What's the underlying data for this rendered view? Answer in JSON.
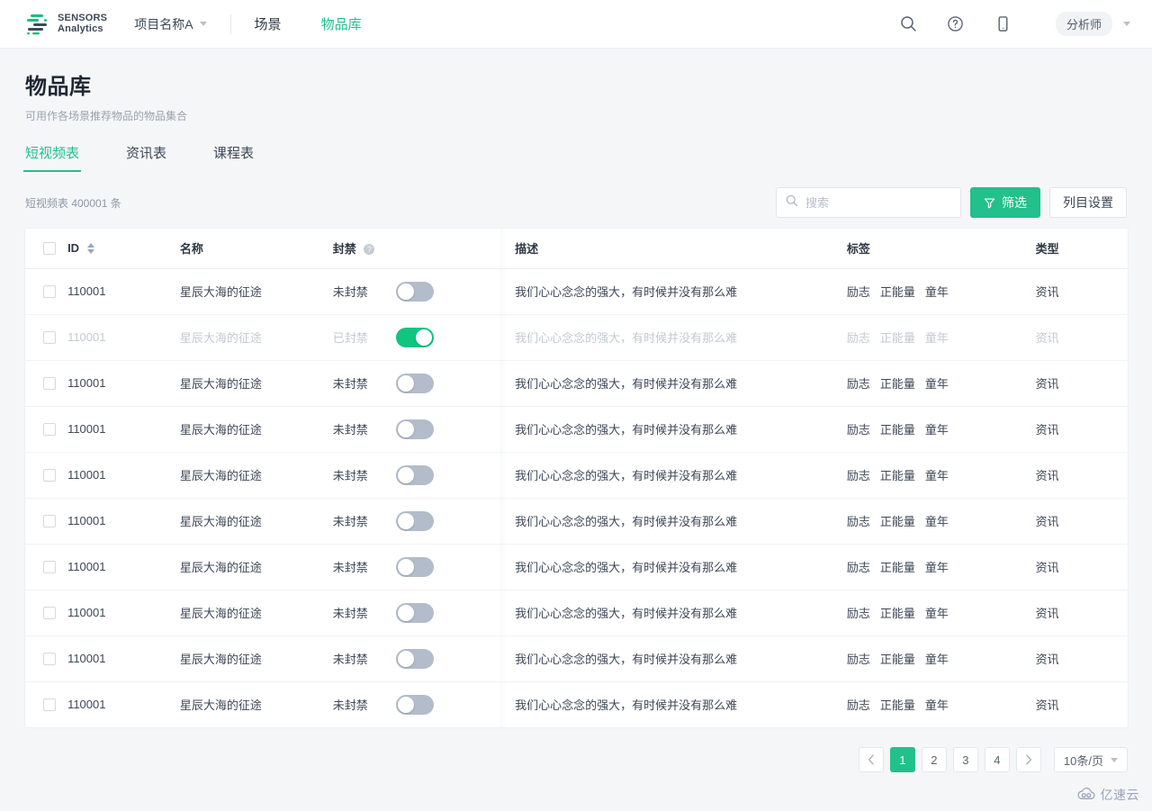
{
  "topbar": {
    "logo": {
      "line1": "SENSORS",
      "line2": "Analytics",
      "icon": "sensors-logo-icon"
    },
    "project": {
      "label": "项目名称A",
      "caret_icon": "chevron-down-icon"
    },
    "nav": [
      {
        "label": "场景",
        "active": false
      },
      {
        "label": "物品库",
        "active": true
      }
    ],
    "icons": [
      {
        "name": "search-icon"
      },
      {
        "name": "help-circle-icon"
      },
      {
        "name": "mobile-icon"
      }
    ],
    "role": {
      "label": "分析师",
      "caret_icon": "chevron-down-icon"
    }
  },
  "page": {
    "title": "物品库",
    "subtitle": "可用作各场景推荐物品的物品集合"
  },
  "tabs": [
    {
      "label": "短视频表",
      "active": true
    },
    {
      "label": "资讯表",
      "active": false
    },
    {
      "label": "课程表",
      "active": false
    }
  ],
  "toolbar": {
    "count_text": "短视频表 400001 条",
    "search": {
      "placeholder": "搜索",
      "value": "",
      "icon": "search-icon"
    },
    "filter_button": {
      "label": "筛选",
      "icon": "filter-funnel-icon"
    },
    "columns_button": {
      "label": "列目设置"
    }
  },
  "table": {
    "columns": [
      {
        "key": "checkbox",
        "label": ""
      },
      {
        "key": "id",
        "label": "ID",
        "sortable": true
      },
      {
        "key": "name",
        "label": "名称"
      },
      {
        "key": "ban",
        "label": "封禁",
        "help": true
      },
      {
        "key": "desc",
        "label": "描述"
      },
      {
        "key": "tags",
        "label": "标签"
      },
      {
        "key": "type",
        "label": "类型"
      }
    ],
    "ban_labels": {
      "on": "已封禁",
      "off": "未封禁"
    },
    "rows": [
      {
        "id": "110001",
        "name": "星辰大海的征途",
        "ban_label": "未封禁",
        "banned": false,
        "desc": "我们心心念念的强大，有时候并没有那么难",
        "tags": [
          "励志",
          "正能量",
          "童年"
        ],
        "type": "资讯",
        "disabled": false
      },
      {
        "id": "110001",
        "name": "星辰大海的征途",
        "ban_label": "已封禁",
        "banned": true,
        "desc": "我们心心念念的强大，有时候并没有那么难",
        "tags": [
          "励志",
          "正能量",
          "童年"
        ],
        "type": "资讯",
        "disabled": true
      },
      {
        "id": "110001",
        "name": "星辰大海的征途",
        "ban_label": "未封禁",
        "banned": false,
        "desc": "我们心心念念的强大，有时候并没有那么难",
        "tags": [
          "励志",
          "正能量",
          "童年"
        ],
        "type": "资讯",
        "disabled": false
      },
      {
        "id": "110001",
        "name": "星辰大海的征途",
        "ban_label": "未封禁",
        "banned": false,
        "desc": "我们心心念念的强大，有时候并没有那么难",
        "tags": [
          "励志",
          "正能量",
          "童年"
        ],
        "type": "资讯",
        "disabled": false
      },
      {
        "id": "110001",
        "name": "星辰大海的征途",
        "ban_label": "未封禁",
        "banned": false,
        "desc": "我们心心念念的强大，有时候并没有那么难",
        "tags": [
          "励志",
          "正能量",
          "童年"
        ],
        "type": "资讯",
        "disabled": false
      },
      {
        "id": "110001",
        "name": "星辰大海的征途",
        "ban_label": "未封禁",
        "banned": false,
        "desc": "我们心心念念的强大，有时候并没有那么难",
        "tags": [
          "励志",
          "正能量",
          "童年"
        ],
        "type": "资讯",
        "disabled": false
      },
      {
        "id": "110001",
        "name": "星辰大海的征途",
        "ban_label": "未封禁",
        "banned": false,
        "desc": "我们心心念念的强大，有时候并没有那么难",
        "tags": [
          "励志",
          "正能量",
          "童年"
        ],
        "type": "资讯",
        "disabled": false
      },
      {
        "id": "110001",
        "name": "星辰大海的征途",
        "ban_label": "未封禁",
        "banned": false,
        "desc": "我们心心念念的强大，有时候并没有那么难",
        "tags": [
          "励志",
          "正能量",
          "童年"
        ],
        "type": "资讯",
        "disabled": false
      },
      {
        "id": "110001",
        "name": "星辰大海的征途",
        "ban_label": "未封禁",
        "banned": false,
        "desc": "我们心心念念的强大，有时候并没有那么难",
        "tags": [
          "励志",
          "正能量",
          "童年"
        ],
        "type": "资讯",
        "disabled": false
      },
      {
        "id": "110001",
        "name": "星辰大海的征途",
        "ban_label": "未封禁",
        "banned": false,
        "desc": "我们心心念念的强大，有时候并没有那么难",
        "tags": [
          "励志",
          "正能量",
          "童年"
        ],
        "type": "资讯",
        "disabled": false
      }
    ]
  },
  "pagination": {
    "prev_icon": "chevron-left-icon",
    "next_icon": "chevron-right-icon",
    "pages": [
      "1",
      "2",
      "3",
      "4"
    ],
    "current": "1",
    "page_size": {
      "label": "10条/页",
      "caret_icon": "chevron-down-icon"
    }
  },
  "watermark": {
    "text": "亿速云",
    "icon": "cloud-icon"
  },
  "colors": {
    "brand_green": "#22c08a",
    "toggle_on": "#11c47f",
    "toggle_off": "#b2bccb",
    "page_bg": "#f5f6f8",
    "text_primary": "#3d4757",
    "text_muted": "#9aa3b0"
  }
}
